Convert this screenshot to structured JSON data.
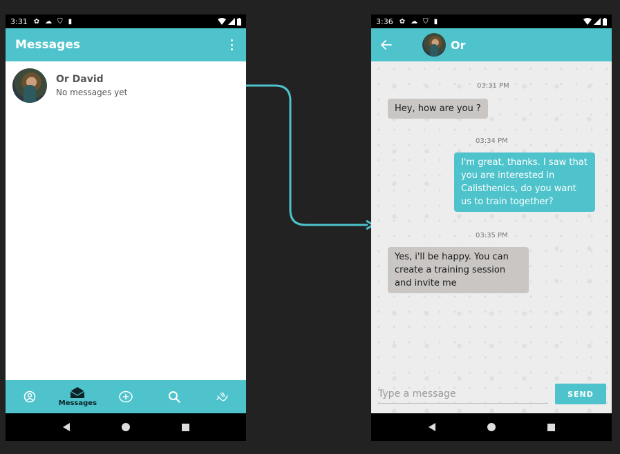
{
  "colors": {
    "accent": "#4ec3cc",
    "background": "#222222",
    "incoming_bubble": "#c9c6c4"
  },
  "left_screen": {
    "status_bar": {
      "time": "3:31"
    },
    "app_bar": {
      "title": "Messages"
    },
    "conversations": [
      {
        "name": "Or David",
        "preview": "No messages yet"
      }
    ],
    "bottom_nav": {
      "items": [
        {
          "icon": "profile-icon",
          "label": ""
        },
        {
          "icon": "envelope-icon",
          "label": "Messages"
        },
        {
          "icon": "add-circle-icon",
          "label": ""
        },
        {
          "icon": "search-icon",
          "label": ""
        },
        {
          "icon": "hand-wave-icon",
          "label": ""
        }
      ]
    }
  },
  "right_screen": {
    "status_bar": {
      "time": "3:36"
    },
    "chat_bar": {
      "contact_name": "Or"
    },
    "messages": [
      {
        "time": "03:31 PM",
        "direction": "incoming",
        "text": "Hey, how are you ?"
      },
      {
        "time": "03:34 PM",
        "direction": "outgoing",
        "text": "I'm great, thanks. I saw that you are interested in Calisthenics, do you want us to train together?"
      },
      {
        "time": "03:35 PM",
        "direction": "incoming",
        "text": "Yes, i'll be happy. You can create a training session and invite me"
      }
    ],
    "composer": {
      "placeholder": "Type a message",
      "send_label": "SEND"
    }
  }
}
